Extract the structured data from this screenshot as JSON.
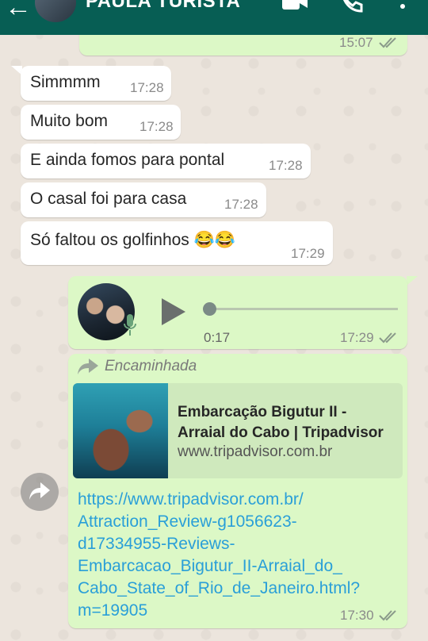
{
  "header": {
    "contact_name": "PAULA TURISTA",
    "back_icon": "arrow-left-icon",
    "video_icon": "video-camera-icon",
    "call_icon": "phone-icon",
    "menu_icon": "more-vertical-icon",
    "bar_color": "#075e54"
  },
  "messages": [
    {
      "time": "15:07",
      "status": "read"
    },
    {
      "text": "Simmmm",
      "time": "17:28"
    },
    {
      "text": "Muito bom",
      "time": "17:28"
    },
    {
      "text": "E ainda fomos para pontal",
      "time": "17:28"
    },
    {
      "text": "O casal foi para casa",
      "time": "17:28"
    },
    {
      "text": "Só faltou os golfinhos 😂😂",
      "time": "17:29"
    }
  ],
  "voice_message": {
    "duration": "0:17",
    "time": "17:29",
    "status": "read"
  },
  "forwarded_message": {
    "forward_label": "Encaminhada",
    "link_preview": {
      "title_line1": "Embarcação Bigutur II -",
      "title_line2": "Arraial do Cabo | Tripadvisor",
      "domain": "www.tripadvisor.com.br"
    },
    "url_lines": [
      "https://www.tripadvisor.com.br/",
      "Attraction_Review-g1056623-",
      "d17334955-Reviews-",
      "Embarcacao_Bigutur_II-Arraial_do_",
      "Cabo_State_of_Rio_de_Janeiro.html?",
      "m=19905"
    ],
    "time": "17:30",
    "status": "read"
  },
  "colors": {
    "incoming_bubble": "#ffffff",
    "outgoing_bubble": "#dcf8c6",
    "link_color": "#2a9fd8"
  }
}
